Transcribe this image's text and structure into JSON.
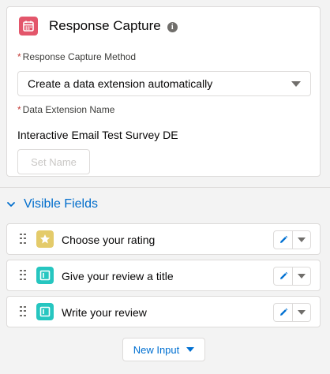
{
  "card": {
    "title": "Response Capture",
    "header_icon": "calendar-icon",
    "header_icon_color": "#e3566b",
    "info_icon": "info-icon",
    "method": {
      "required_marker": "*",
      "label": "Response Capture Method",
      "value": "Create a data extension automatically"
    },
    "de_name": {
      "required_marker": "*",
      "label": "Data Extension Name",
      "value": "Interactive Email Test Survey DE"
    },
    "set_name_button": "Set Name"
  },
  "section": {
    "title": "Visible Fields",
    "expanded": true
  },
  "fields": [
    {
      "label": "Choose your rating",
      "icon": "star-icon",
      "icon_color": "#e4cb6a"
    },
    {
      "label": "Give your review a title",
      "icon": "text-field-icon",
      "icon_color": "#26c6c0"
    },
    {
      "label": "Write your review",
      "icon": "text-field-icon",
      "icon_color": "#26c6c0"
    }
  ],
  "new_input_button": "New Input",
  "colors": {
    "accent": "#0070d2",
    "border": "#dddbda",
    "required": "#c23934"
  }
}
